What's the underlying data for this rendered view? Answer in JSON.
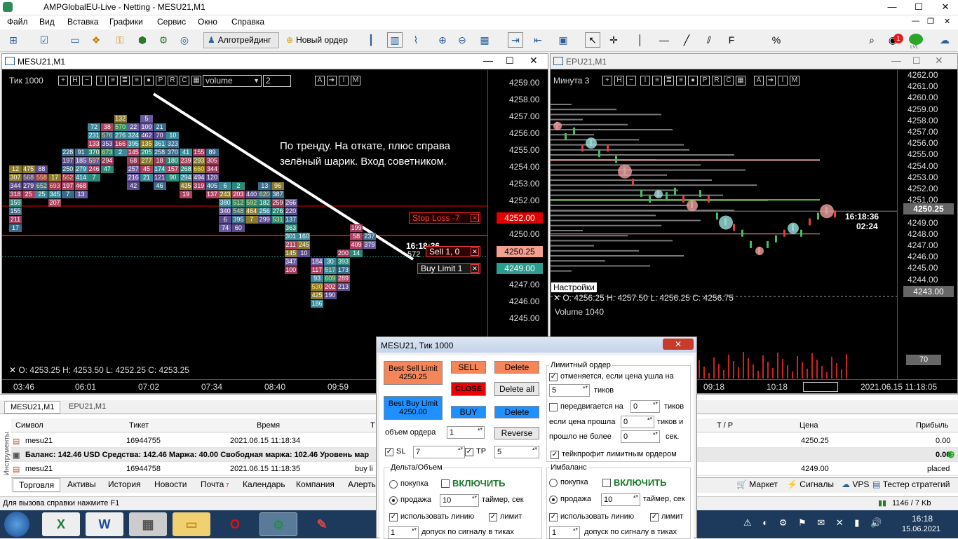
{
  "window": {
    "title": "AMPGlobalEU-Live - Netting - MESU21,M1"
  },
  "menu": [
    "Файл",
    "Вид",
    "Вставка",
    "Графики",
    "Сервис",
    "Окно",
    "Справка"
  ],
  "toolbar": {
    "algo_label": "Алготрейдинг",
    "new_order_label": "Новый ордер",
    "notif_count": "1",
    "lvl_label": "LVL"
  },
  "left_chart": {
    "title": "MESU21,M1",
    "mode_label": "Тик  1000",
    "indicator_select": "volume",
    "indicator_param": "2",
    "annotation": "По тренду. На откате, плюс справа зелёный шарик. Вход советником.",
    "ohlc": "O: 4253.25   H: 4253.50   L: 4252.25   C: 4253.25",
    "timer": "16:18:36",
    "timer_sub": "572",
    "price_axis": [
      "4259.00",
      "4258.00",
      "4257.00",
      "4256.00",
      "4255.00",
      "4254.00",
      "4253.00",
      "4252.00",
      "4251.00",
      "4250.00",
      "4249.00",
      "4248.00",
      "4247.00",
      "4246.00",
      "4245.00"
    ],
    "time_axis": [
      "03:46",
      "06:01",
      "07:02",
      "07:34",
      "08:40",
      "09:59"
    ],
    "stop_loss_label": "Stop Loss  -7",
    "stop_loss_price": "4252.00",
    "sell_label": "Sell  1,  0",
    "sell_price": "4250.25",
    "buy_limit_label": "Buy Limit  1",
    "buy_limit_price": "4249.00",
    "colors": {
      "stop": "#e00000",
      "sell": "#f4a090",
      "buy": "#2a9d8f"
    }
  },
  "cluster_columns": [
    {
      "col": 0,
      "top": "4254.0",
      "vals": [
        "12",
        "307",
        "344",
        "318",
        "159",
        "155",
        "211",
        "17"
      ]
    },
    {
      "col": 1,
      "top": "4254.0",
      "vals": [
        "475",
        "568",
        "279",
        "25"
      ]
    },
    {
      "col": 2,
      "top": "4254.0",
      "vals": [
        "88",
        "558",
        "652",
        "25"
      ]
    },
    {
      "col": 3,
      "top": "4253.5",
      "vals": [
        "17",
        "693",
        "345",
        "207"
      ]
    },
    {
      "col": 4,
      "top": "4255.0",
      "vals": [
        "228",
        "197",
        "250",
        "562",
        "197",
        "7"
      ]
    },
    {
      "col": 5,
      "top": "4255.0",
      "vals": [
        "91",
        "185",
        "279",
        "414",
        "468",
        "13"
      ]
    },
    {
      "col": 6,
      "top": "4256.5",
      "vals": [
        "72",
        "231",
        "133",
        "370",
        "597",
        "246",
        "7"
      ]
    },
    {
      "col": 7,
      "top": "4256.5",
      "vals": [
        "38",
        "576",
        "353",
        "673",
        "294",
        "47"
      ]
    },
    {
      "col": 8,
      "top": "4257.0",
      "vals": [
        "132",
        "570",
        "276",
        "166",
        "2"
      ]
    },
    {
      "col": 9,
      "top": "4256.5",
      "vals": [
        "22",
        "324",
        "395",
        "145",
        "68",
        "257",
        "216",
        "42"
      ]
    },
    {
      "col": 10,
      "top": "4257.0",
      "vals": [
        "5",
        "100",
        "462",
        "135",
        "205",
        "277",
        "45",
        "21"
      ]
    },
    {
      "col": 11,
      "top": "4256.5",
      "vals": [
        "21",
        "70",
        "361",
        "258",
        "18",
        "174",
        "121",
        "46"
      ]
    },
    {
      "col": 12,
      "top": "4256.0",
      "vals": [
        "10",
        "323",
        "370",
        "180",
        "157",
        "90"
      ]
    },
    {
      "col": 13,
      "top": "4255.0",
      "vals": [
        "41",
        "239",
        "268",
        "294",
        "435",
        "19"
      ]
    },
    {
      "col": 14,
      "top": "4255.0",
      "vals": [
        "155",
        "293",
        "660",
        "494",
        "319"
      ]
    },
    {
      "col": 15,
      "top": "4255.0",
      "vals": [
        "89",
        "305",
        "344",
        "120",
        "405",
        "137"
      ]
    },
    {
      "col": 16,
      "top": "4253.0",
      "vals": [
        "6",
        "243",
        "380",
        "340",
        "6",
        "74"
      ]
    },
    {
      "col": 17,
      "top": "4253.0",
      "vals": [
        "2",
        "203",
        "512",
        "548",
        "395",
        "60"
      ]
    },
    {
      "col": 18,
      "top": "4252.5",
      "vals": [
        "440",
        "592",
        "464",
        "7"
      ]
    },
    {
      "col": 19,
      "top": "4253.0",
      "vals": [
        "13",
        "620",
        "182",
        "256",
        "299"
      ]
    },
    {
      "col": 20,
      "top": "4253.0",
      "vals": [
        "96",
        "387",
        "259",
        "276",
        "531"
      ]
    },
    {
      "col": 21,
      "top": "4252.0",
      "vals": [
        "266",
        "220",
        "137",
        "363",
        "301",
        "211",
        "145",
        "347",
        "100"
      ]
    },
    {
      "col": 22,
      "top": "4250.0",
      "vals": [
        "160",
        "245",
        "10"
      ]
    },
    {
      "col": 23,
      "top": "4248.5",
      "vals": [
        "184",
        "117",
        "93",
        "530",
        "425",
        "186"
      ]
    },
    {
      "col": 24,
      "top": "4248.5",
      "vals": [
        "30",
        "517",
        "609",
        "202",
        "190"
      ]
    },
    {
      "col": 25,
      "top": "4249.0",
      "vals": [
        "200",
        "393",
        "173",
        "289",
        "213"
      ]
    },
    {
      "col": 26,
      "top": "4250.5",
      "vals": [
        "199",
        "58",
        "409",
        "14"
      ]
    },
    {
      "col": 27,
      "top": "4250.0",
      "vals": [
        "237",
        "379"
      ]
    }
  ],
  "right_chart": {
    "title": "EPU21,M1",
    "mode_label": "Минута  3",
    "ohlc": "O: 4256.25   H: 4257.50   L: 4256.25   C: 4256.75",
    "settings_label": "Настройки",
    "timer": "16:18:36",
    "timer_sub": "02:24",
    "current_price": "4250.25",
    "crosshair_price": "4243.00",
    "volume_label": "Volume 1040",
    "volume_axis": "70",
    "price_axis": [
      "4262.00",
      "4261.00",
      "4260.00",
      "4259.00",
      "4258.00",
      "4257.00",
      "4256.00",
      "4255.00",
      "4254.00",
      "4253.00",
      "4252.00",
      "4251.00",
      "4250.00",
      "4249.00",
      "4248.00",
      "4247.00",
      "4246.00",
      "4245.00",
      "4244.00"
    ],
    "time_axis": [
      "09:18",
      "10:18"
    ],
    "date_label": "2021.06.15 11:18:05"
  },
  "dialog": {
    "title": "MESU21, Тик  1000",
    "best_sell": "Best Sell Limit",
    "best_sell_price": "4250.25",
    "best_buy": "Best Buy Limit",
    "best_buy_price": "4250.00",
    "sell": "SELL",
    "close": "CLOSE",
    "buy": "BUY",
    "delete": "Delete",
    "delete_all": "Delete all",
    "reverse": "Reverse",
    "volume_label": "объем ордера",
    "volume_value": "1",
    "sl_label": "SL",
    "sl_value": "7",
    "tp_label": "TP",
    "tp_value": "5",
    "limit_group": "Лимитный ордер",
    "cancel_if": "отменяется, если цена ушла на",
    "cancel_ticks": "5",
    "ticks": "тиков",
    "ticks2": "тиков",
    "moves_on": "передвигается на",
    "moves_value": "0",
    "if_price": "если цена прошла",
    "if_price_value": "0",
    "ticks_and": "тиков и",
    "passed_max": "прошло не более",
    "passed_value": "0",
    "sec": "сек.",
    "tp_limit": "тейкпрофит лимитным ордером",
    "delta_group": "Дельта/Объем",
    "buy_opt": "покупка",
    "sell_opt": "продажа",
    "enable": "ВКЛЮЧИТЬ",
    "timer_value": "10",
    "timer_label": "таймер, сек",
    "timer_label2": "таймер, сек",
    "use_line": "использовать линию",
    "limit": "лимит",
    "tolerance_value": "1",
    "tolerance_label": "допуск по сигналу в тиках",
    "imb_group": "Имбаланс",
    "imb_timer_value": "10",
    "imb_tol_value": "1"
  },
  "terminal": {
    "tabs_top": [
      "MESU21,M1",
      "EPU21,M1"
    ],
    "headers": [
      "Символ",
      "Тикет",
      "Время",
      "Т",
      "T / P",
      "Цена",
      "Прибыль"
    ],
    "rows": [
      {
        "symbol": "mesu21",
        "ticket": "16944755",
        "time": "2021.06.15 11:18:34",
        "type": "",
        "price": "4250.25",
        "profit": "0.00"
      },
      {
        "symbol": "mesu21",
        "ticket": "16944758",
        "time": "2021.06.15 11:18:35",
        "type": "buy li",
        "price": "4249.00",
        "profit": "placed"
      }
    ],
    "balance_line": "Баланс: 142.46 USD  Средства: 142.46  Маржа: 40.00  Свободная маржа: 102.46  Уровень мар",
    "balance_profit": "0.00",
    "side_label": "Инструменты",
    "bottom_tabs": [
      "Торговля",
      "Активы",
      "История",
      "Новости",
      "Почта",
      "Календарь",
      "Компания",
      "Алерты"
    ],
    "mail_count": "7",
    "right_tabs": [
      "Маркет",
      "Сигналы",
      "VPS",
      "Тестер стратегий"
    ]
  },
  "status": {
    "help": "Для вызова справки нажмите F1",
    "traffic": "1146 / 7 Kb"
  },
  "taskbar": {
    "time": "16:18",
    "date": "15.06.2021"
  }
}
